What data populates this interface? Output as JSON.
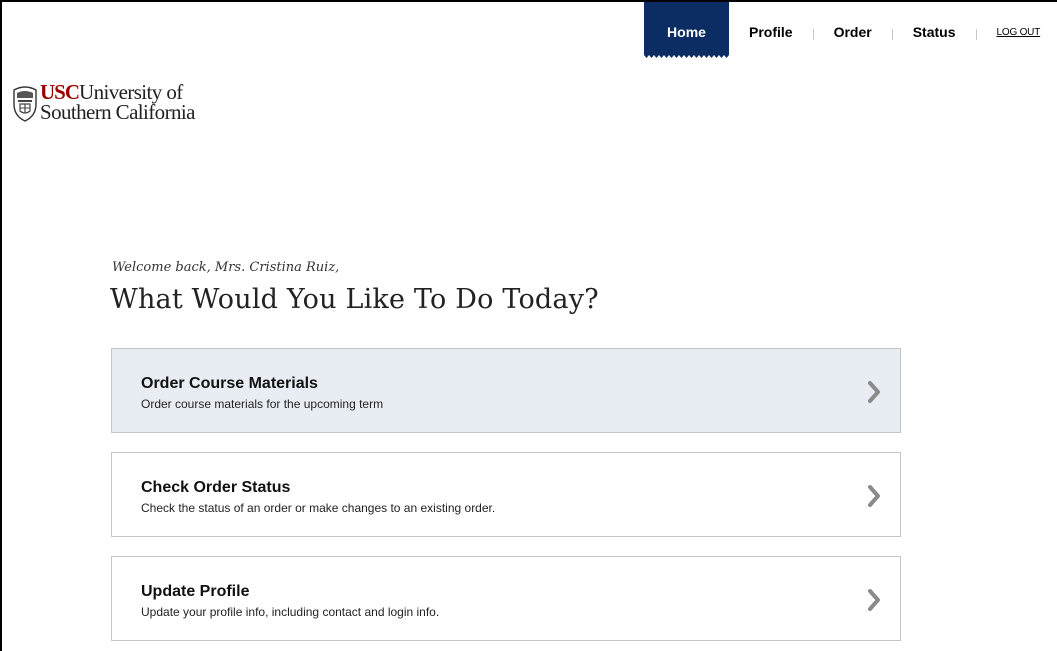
{
  "nav": {
    "home": "Home",
    "profile": "Profile",
    "order": "Order",
    "status": "Status",
    "logout": "LOG OUT"
  },
  "logo": {
    "usc": "USC",
    "line1": "University of",
    "line2": "Southern California",
    "icon": "usc-seal-icon"
  },
  "welcome": "Welcome back, Mrs. Cristina Ruiz,",
  "headline": "What Would You Like To Do Today?",
  "actions": [
    {
      "title": "Order Course Materials",
      "description": "Order course materials for the upcoming term",
      "icon": "chevron-right-icon"
    },
    {
      "title": "Check Order Status",
      "description": "Check the status of an order or make changes to an existing order.",
      "icon": "chevron-right-icon"
    },
    {
      "title": "Update Profile",
      "description": "Update your profile info, including contact and login info.",
      "icon": "chevron-right-icon"
    }
  ],
  "colors": {
    "nav_active_bg": "#0b2d63",
    "usc_red": "#990000",
    "active_card_bg": "#e8edf4",
    "card_border": "#c6c6c6"
  }
}
